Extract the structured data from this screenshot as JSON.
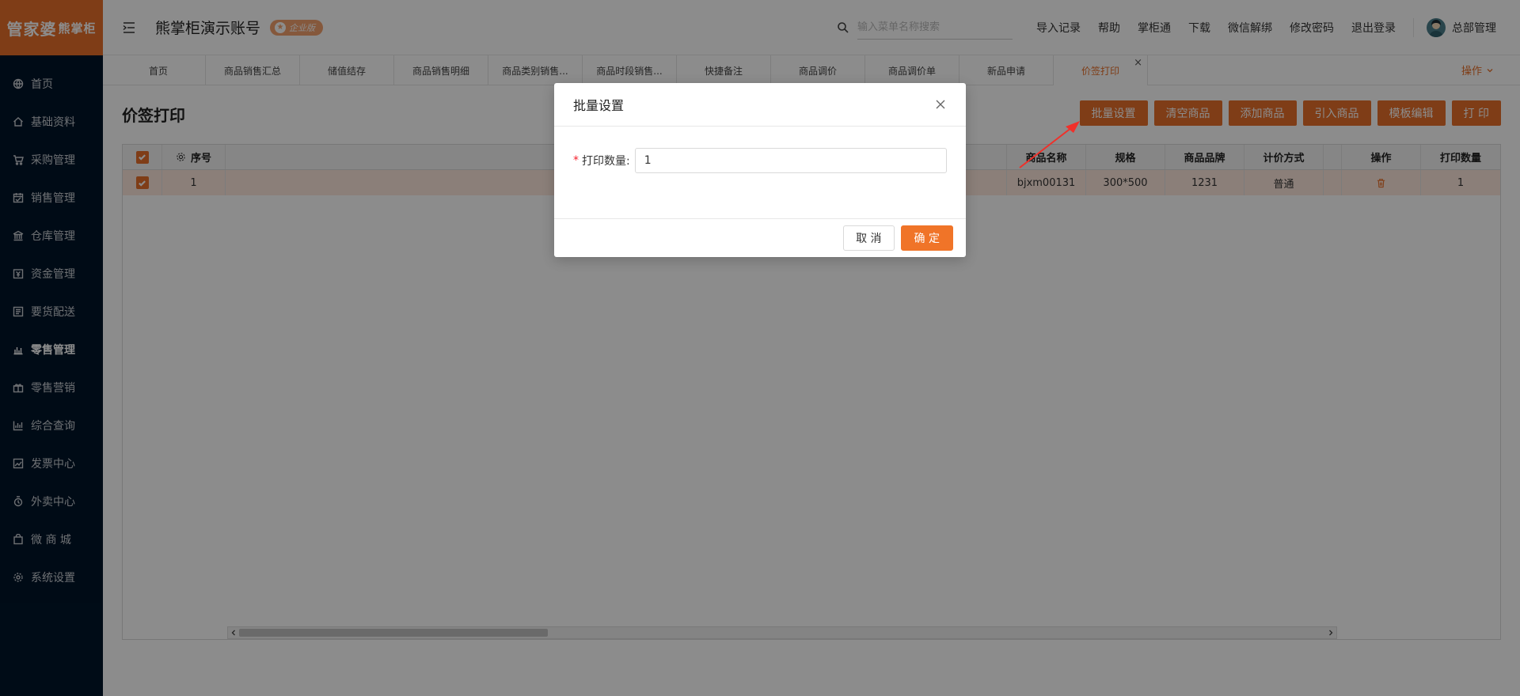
{
  "sidebar": {
    "logo_main": "管家婆",
    "logo_sub": "熊掌柜",
    "items": [
      {
        "label": "首页",
        "icon": "globe-icon"
      },
      {
        "label": "基础资料",
        "icon": "home-icon"
      },
      {
        "label": "采购管理",
        "icon": "cart-icon"
      },
      {
        "label": "销售管理",
        "icon": "calendar-icon"
      },
      {
        "label": "仓库管理",
        "icon": "bank-icon"
      },
      {
        "label": "资金管理",
        "icon": "money-icon"
      },
      {
        "label": "要货配送",
        "icon": "list-icon"
      },
      {
        "label": "零售管理",
        "icon": "chart-icon"
      },
      {
        "label": "零售营销",
        "icon": "gift-icon"
      },
      {
        "label": "综合查询",
        "icon": "bar-chart-icon"
      },
      {
        "label": "发票中心",
        "icon": "line-chart-icon"
      },
      {
        "label": "外卖中心",
        "icon": "delivery-icon"
      },
      {
        "label": "微 商 城",
        "icon": "shop-icon"
      },
      {
        "label": "系统设置",
        "icon": "gear-icon"
      }
    ],
    "active_index": 7
  },
  "header": {
    "account_name": "熊掌柜演示账号",
    "edition_badge": "企业版",
    "search_placeholder": "输入菜单名称搜索",
    "links": [
      "导入记录",
      "帮助",
      "掌柜通",
      "下载",
      "微信解绑",
      "修改密码",
      "退出登录"
    ],
    "user_name": "总部管理"
  },
  "tabs": {
    "items": [
      "首页",
      "商品销售汇总",
      "储值结存",
      "商品销售明细",
      "商品类别销售...",
      "商品时段销售...",
      "快捷备注",
      "商品调价",
      "商品调价单",
      "新品申请",
      "价签打印"
    ],
    "active_index": 10,
    "close_symbol": "×",
    "ops_label": "操作"
  },
  "page": {
    "title": "价签打印",
    "toolbar": [
      "批量设置",
      "清空商品",
      "添加商品",
      "引入商品",
      "模板编辑",
      "打 印"
    ]
  },
  "table": {
    "headers": {
      "seq": "序号",
      "name": "商品名称",
      "spec": "规格",
      "brand": "商品品牌",
      "pricing": "计价方式",
      "op": "操作",
      "qty": "打印数量"
    },
    "rows": [
      {
        "seq": "1",
        "name": "bjxm00131",
        "spec": "300*500",
        "brand": "1231",
        "pricing": "普通",
        "qty": "1"
      }
    ]
  },
  "modal": {
    "title": "批量设置",
    "field_required_mark": "*",
    "field_label": "打印数量:",
    "field_value": "1",
    "cancel_label": "取 消",
    "ok_label": "确 定"
  },
  "colors": {
    "accent": "#e8702a",
    "sidebar_bg": "#001529",
    "row_selected": "#fde7dc",
    "annotation_arrow": "#f0302a"
  }
}
